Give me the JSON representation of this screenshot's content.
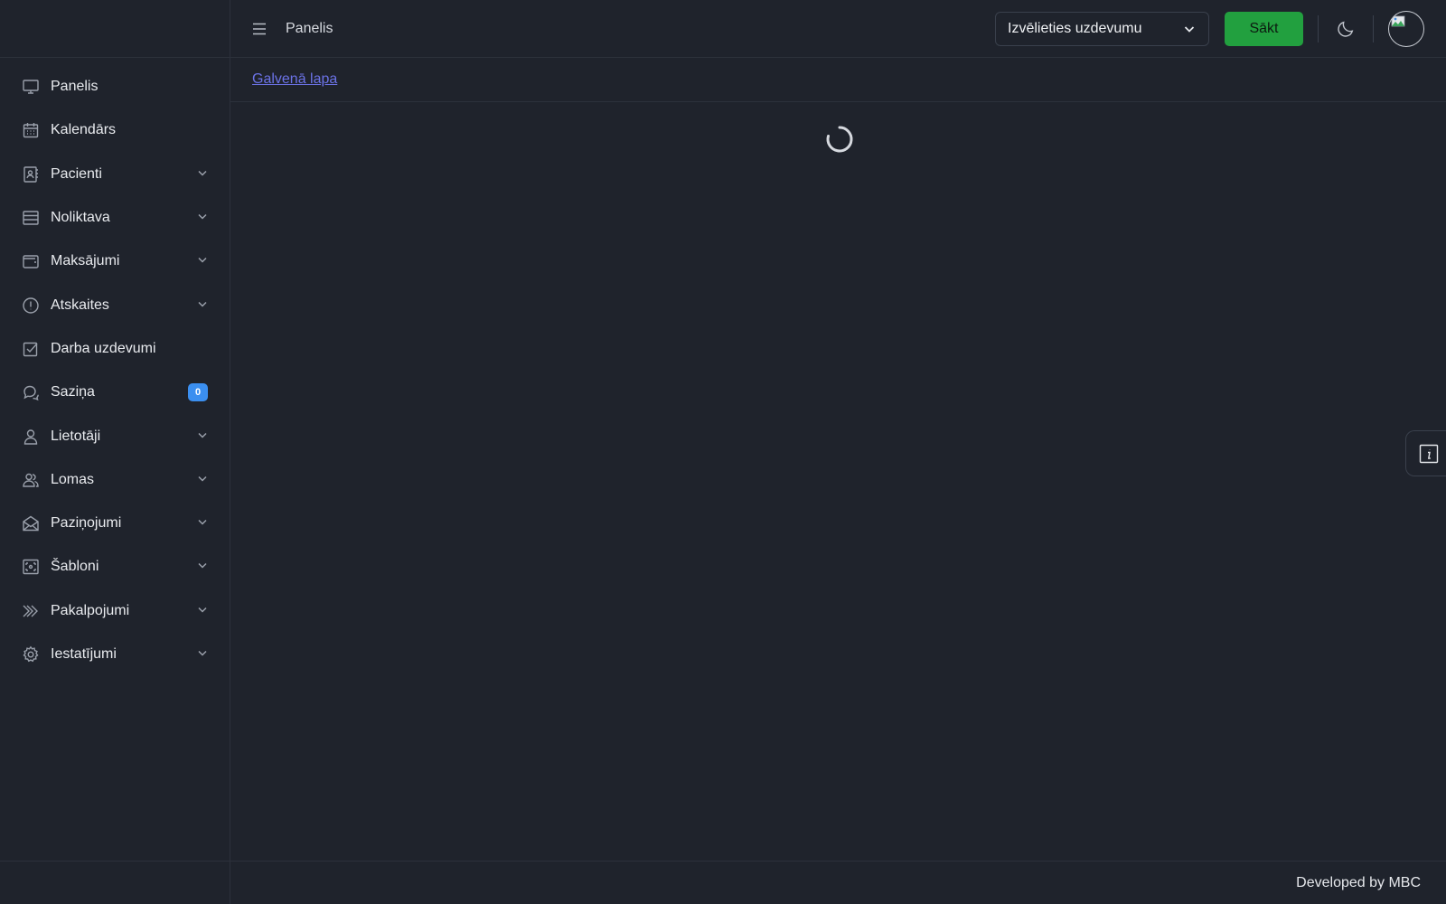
{
  "header": {
    "title": "Panelis",
    "task_select": {
      "value": "Izvēlieties uzdevumu"
    },
    "start_label": "Sākt"
  },
  "breadcrumb": {
    "home_label": "Galvenā lapa"
  },
  "sidebar": {
    "items": [
      {
        "label": "Panelis",
        "icon": "monitor-icon",
        "chevron": false
      },
      {
        "label": "Kalendārs",
        "icon": "calendar-icon",
        "chevron": false
      },
      {
        "label": "Pacienti",
        "icon": "contact-book-icon",
        "chevron": true
      },
      {
        "label": "Noliktava",
        "icon": "list-rows-icon",
        "chevron": true
      },
      {
        "label": "Maksājumi",
        "icon": "wallet-icon",
        "chevron": true
      },
      {
        "label": "Atskaites",
        "icon": "alert-circle-icon",
        "chevron": true
      },
      {
        "label": "Darba uzdevumi",
        "icon": "checkbox-icon",
        "chevron": false
      },
      {
        "label": "Saziņa",
        "icon": "chat-bubbles-icon",
        "chevron": false,
        "badge": "0"
      },
      {
        "label": "Lietotāji",
        "icon": "user-icon",
        "chevron": true
      },
      {
        "label": "Lomas",
        "icon": "users-icon",
        "chevron": true
      },
      {
        "label": "Paziņojumi",
        "icon": "envelope-icon",
        "chevron": true
      },
      {
        "label": "Šabloni",
        "icon": "template-frame-icon",
        "chevron": true
      },
      {
        "label": "Pakalpojumi",
        "icon": "double-chevron-right-icon",
        "chevron": true
      },
      {
        "label": "Iestatījumi",
        "icon": "gear-icon",
        "chevron": true
      }
    ]
  },
  "footer": {
    "credit": "Developed by MBC"
  },
  "colors": {
    "background": "#1f232c",
    "border": "#2c313b",
    "accent_green": "#22a03f",
    "badge_blue": "#3b8ff0",
    "link": "#6b72e6"
  }
}
